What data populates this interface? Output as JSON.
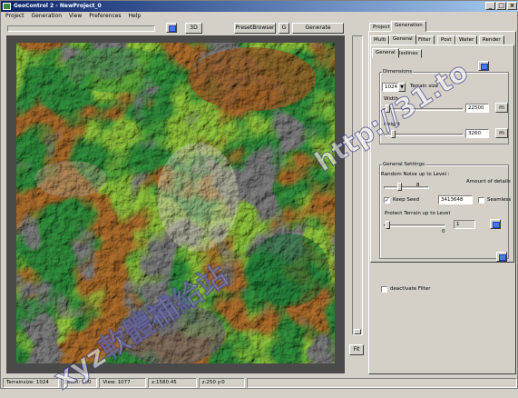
{
  "window": {
    "title": "GeoControl 2 - NewProject_0"
  },
  "titlebar_buttons": [
    "_",
    "□",
    "×"
  ],
  "menu": [
    "Project",
    "Generation",
    "View",
    "Preferences",
    "Help"
  ],
  "toolbar": {
    "btn_3d": "3D",
    "btn_preset": "PresetBrowser",
    "btn_g": "G",
    "btn_generate": "Generate"
  },
  "right_panel": {
    "top_tabs": [
      "Project",
      "Generation"
    ],
    "sub_tabs": [
      "Multi",
      "General",
      "Filter",
      "Post",
      "Water",
      "Render"
    ],
    "inner_tabs": [
      "General",
      "Isolines"
    ],
    "dimensions": {
      "group_label": "Dimensions",
      "size_value": "1024",
      "terrain_size_label": "Terrain size",
      "width_label": "Width",
      "width_value": "22500",
      "width_unit": "m",
      "height_label": "Height",
      "height_value": "3260",
      "height_unit": "m"
    },
    "general_settings": {
      "group_label": "General Settings",
      "random_noise_label": "Random Noise up to Level :",
      "random_noise_value": "8",
      "amount_label": "Amount of details",
      "keep_seed_label": "Keep Seed",
      "seed_value": "3413648",
      "seamless_label": "Seamless",
      "protect_label": "Protect Terrain up to Level",
      "protect_level": "0",
      "protect_value": "1"
    },
    "deactivate_filter_label": "deactivate Filter"
  },
  "fit_button": "Fit",
  "status": {
    "terrainsize": "Terrainsize: 1024",
    "zoom": "Zoom: 100",
    "view": "View: 1077",
    "x": "x:1580.45",
    "y": "z:250 y:0"
  },
  "watermark": {
    "text1": "xyz軟體補給站",
    "text2": "http://31.to"
  }
}
